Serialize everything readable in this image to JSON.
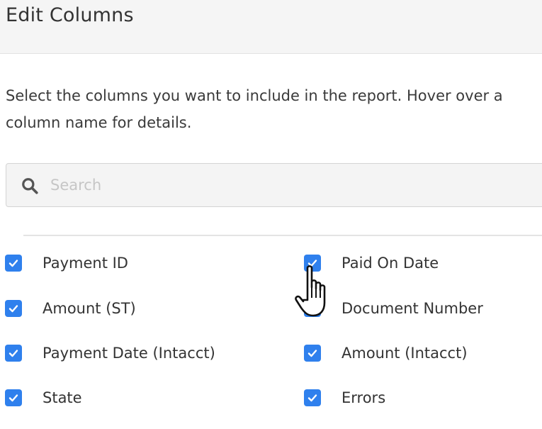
{
  "dialog": {
    "title": "Edit Columns",
    "description": "Select the columns you want to include in the report. Hover over a column name for details."
  },
  "search": {
    "placeholder": "Search",
    "value": ""
  },
  "columns": {
    "left": [
      {
        "label": "Payment ID",
        "checked": true
      },
      {
        "label": "Amount (ST)",
        "checked": true
      },
      {
        "label": "Payment Date (Intacct)",
        "checked": true
      },
      {
        "label": "State",
        "checked": true
      }
    ],
    "right": [
      {
        "label": "Paid On Date",
        "checked": true
      },
      {
        "label": "Document Number",
        "checked": true
      },
      {
        "label": "Amount (Intacct)",
        "checked": true
      },
      {
        "label": "Errors",
        "checked": true
      }
    ]
  },
  "colors": {
    "accent": "#2f80ed",
    "header_bg": "#f5f5f5",
    "search_bg": "#f4f4f4"
  },
  "icons": {
    "search": "search-icon",
    "checkbox": "checkmark-icon",
    "cursor": "hand-pointer-icon"
  }
}
